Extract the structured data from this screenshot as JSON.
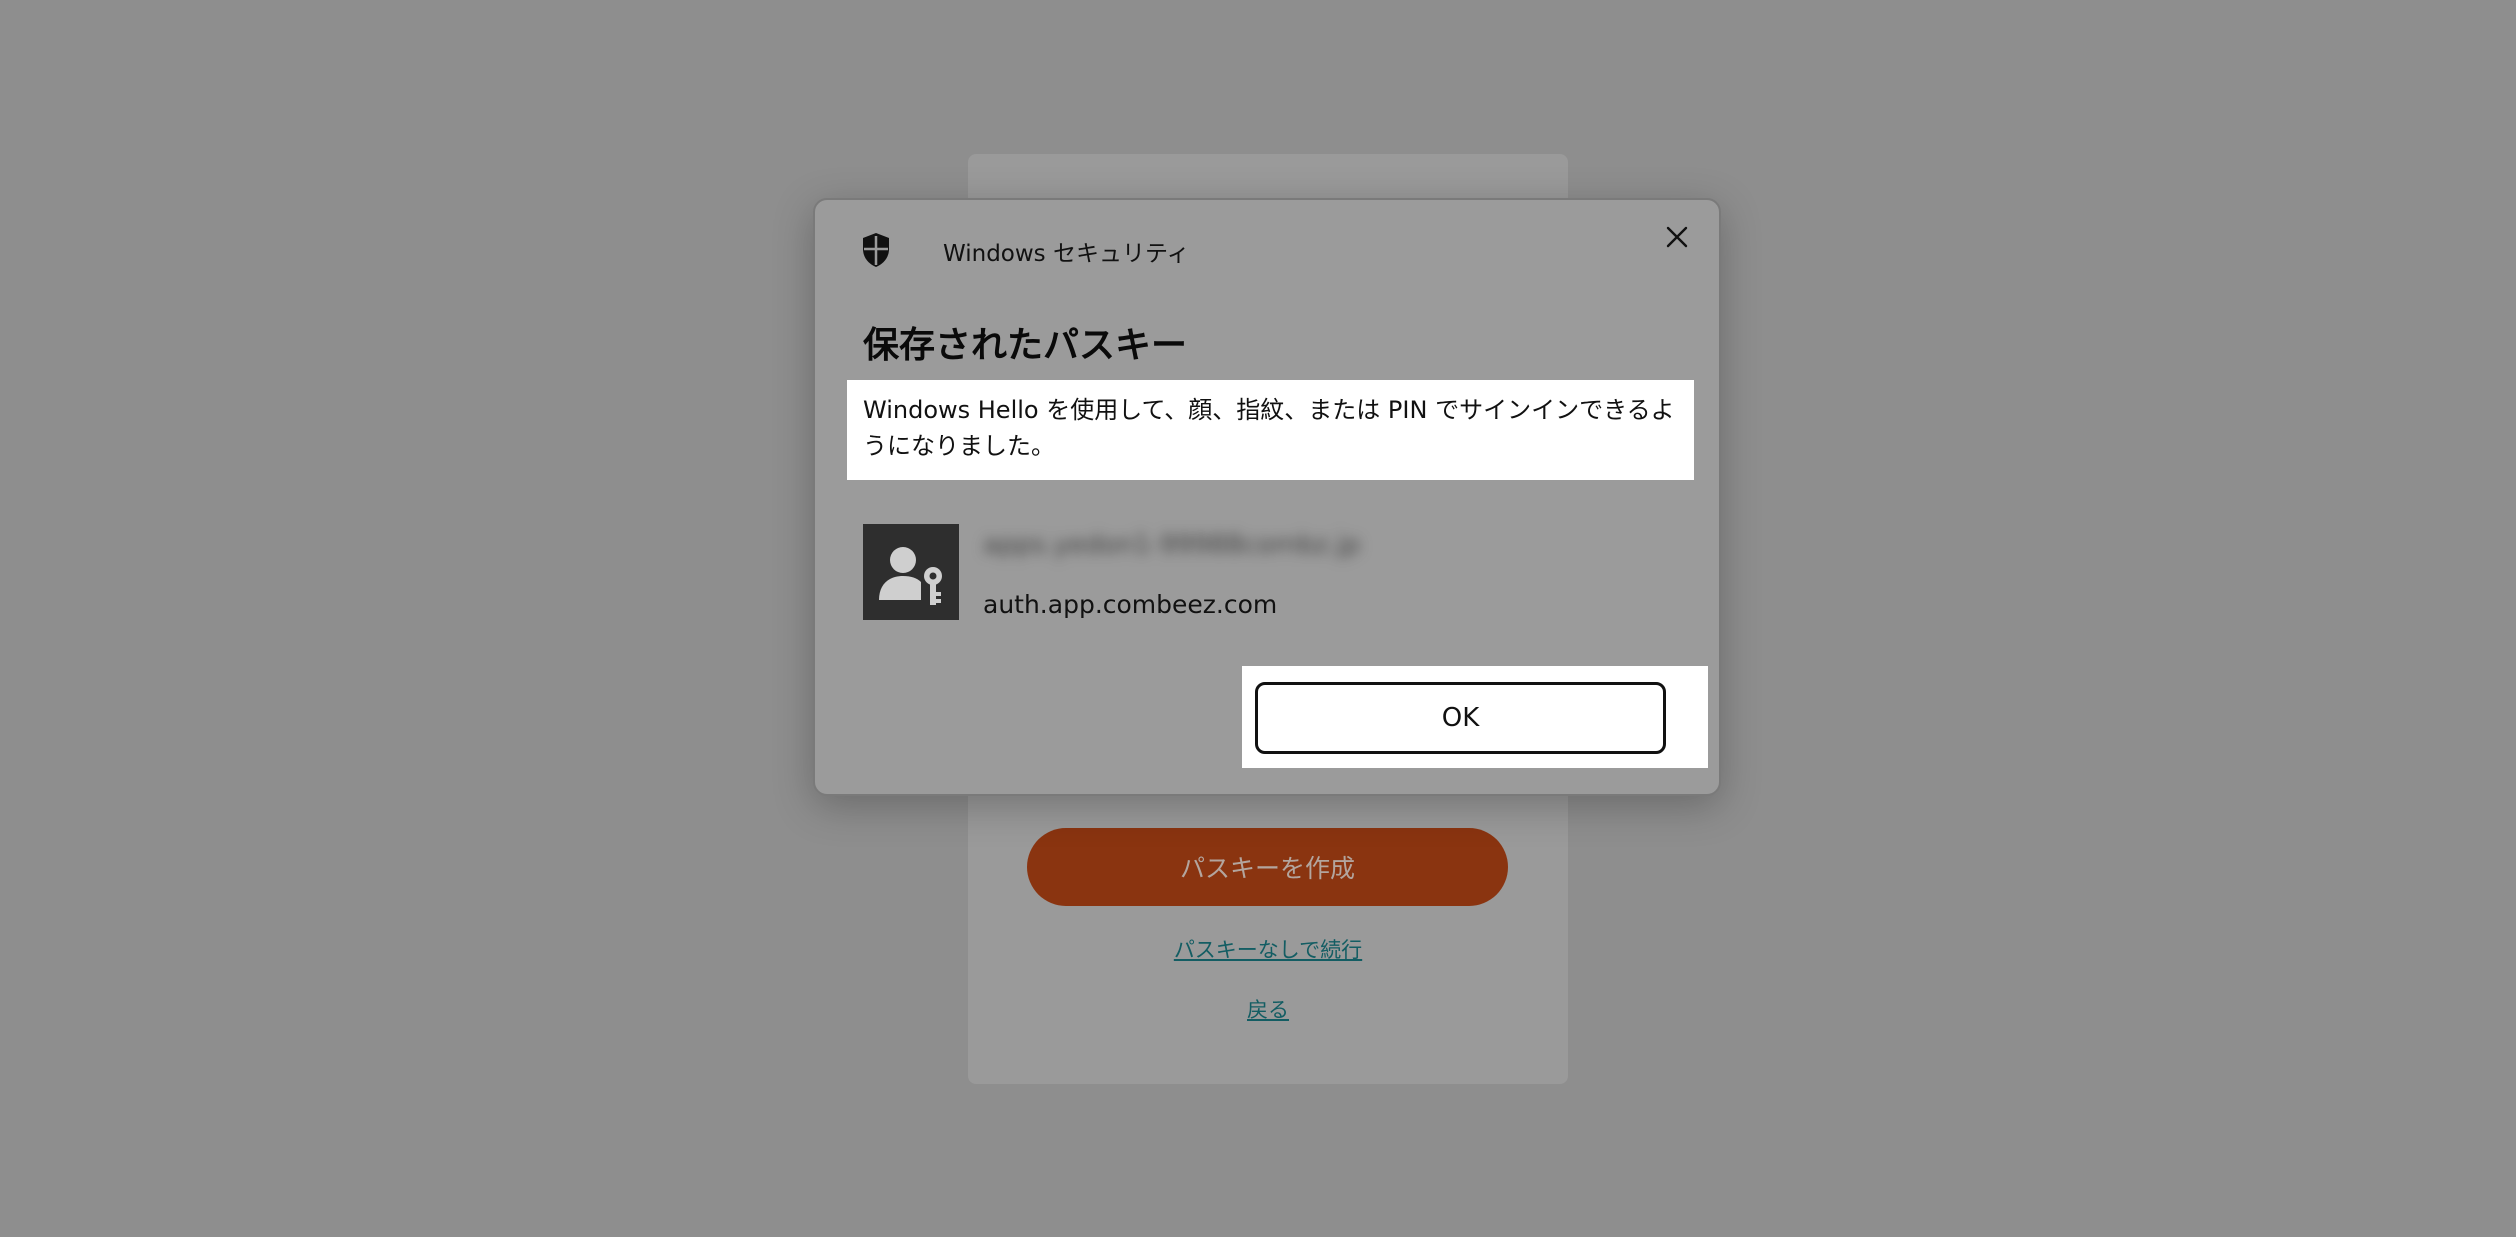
{
  "background_page": {
    "create_button_label": "パスキーを作成",
    "continue_link": "パスキーなしで続行",
    "back_link": "戻る"
  },
  "dialog": {
    "title": "Windows セキュリティ",
    "heading": "保存されたパスキー",
    "message": "Windows Hello を使用して、顔、指紋、または PIN でサインインできるようになりました。",
    "account_name": "apps.yedon1-99988combz.jp",
    "domain": "auth.app.combeez.com",
    "ok_label": "OK"
  },
  "icons": {
    "shield": "shield-icon",
    "close": "close-icon",
    "passkey_avatar": "user-key-icon"
  },
  "colors": {
    "overlay": "#8e8e8e",
    "dialog_bg": "#9b9b9b",
    "create_button": "#8a3410",
    "link": "#135d63"
  }
}
